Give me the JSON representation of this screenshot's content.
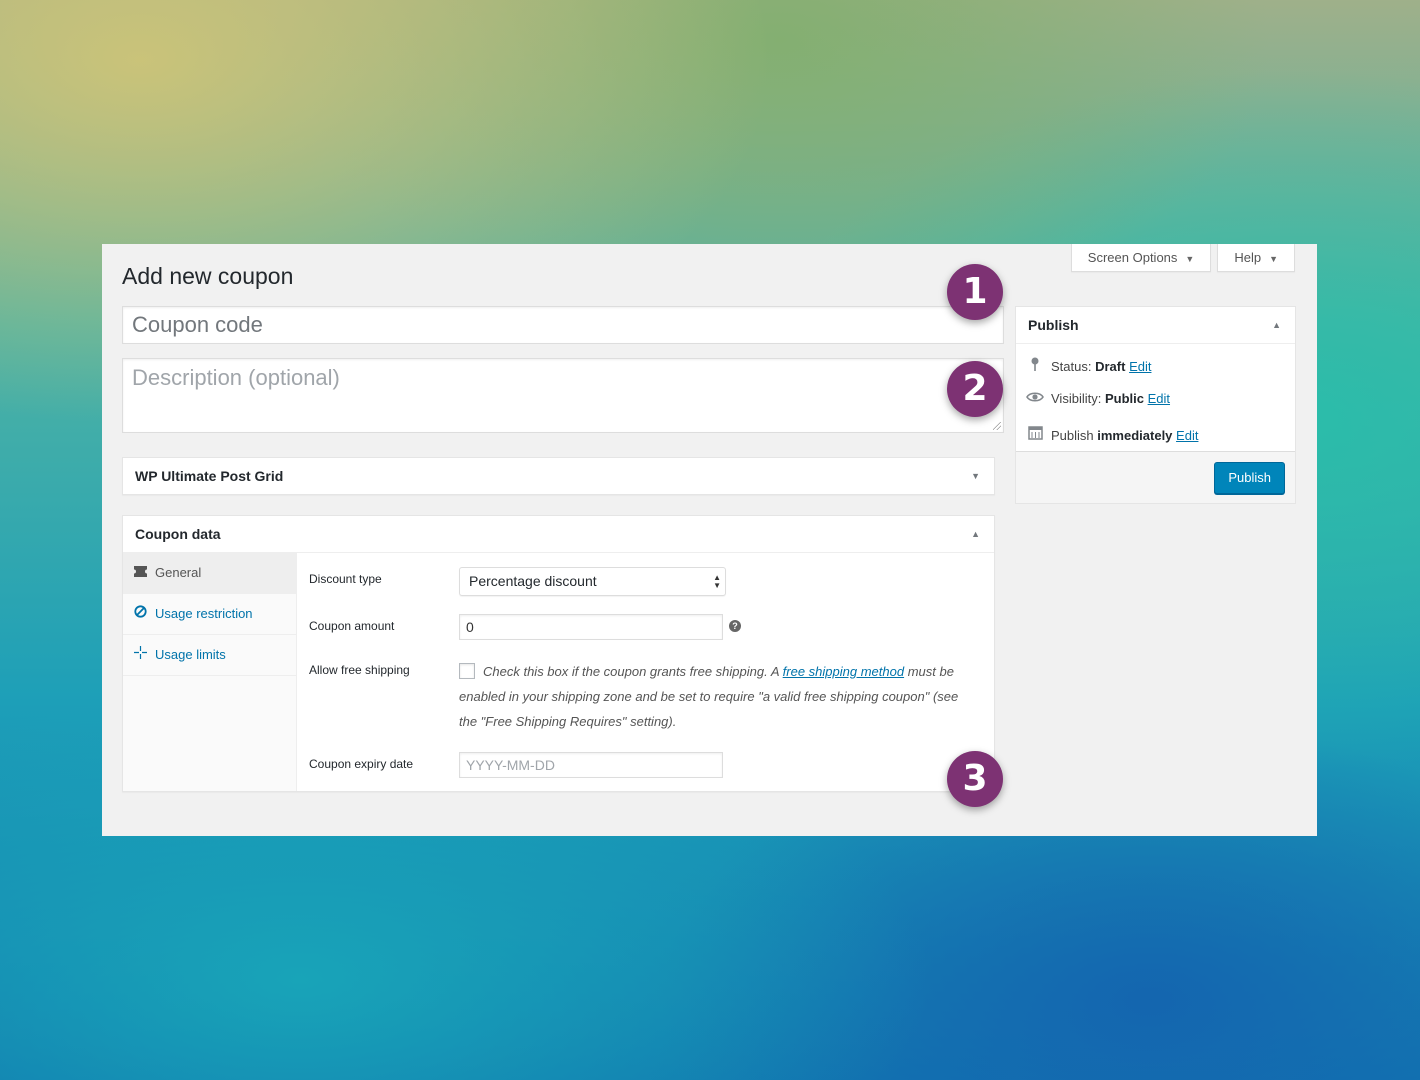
{
  "top_tabs": {
    "screen_options": "Screen Options",
    "help": "Help"
  },
  "page_title": "Add new coupon",
  "coupon_code": {
    "placeholder": "Coupon code"
  },
  "description": {
    "placeholder": "Description (optional)"
  },
  "metaboxes": {
    "ultimate_post_grid": {
      "title": "WP Ultimate Post Grid"
    },
    "coupon_data": {
      "title": "Coupon data"
    }
  },
  "coupon_tabs": [
    {
      "label": "General",
      "icon": "ticket-icon"
    },
    {
      "label": "Usage restriction",
      "icon": "block-icon"
    },
    {
      "label": "Usage limits",
      "icon": "crosshair-icon"
    }
  ],
  "general": {
    "discount_type": {
      "label": "Discount type",
      "value": "Percentage discount"
    },
    "coupon_amount": {
      "label": "Coupon amount",
      "value": "0"
    },
    "free_shipping": {
      "label": "Allow free shipping",
      "desc_before": "Check this box if the coupon grants free shipping. A ",
      "link_text": "free shipping method",
      "desc_after": " must be enabled in your shipping zone and be set to require \"a valid free shipping coupon\" (see the \"Free Shipping Requires\" setting)."
    },
    "expiry": {
      "label": "Coupon expiry date",
      "placeholder": "YYYY-MM-DD"
    }
  },
  "publish": {
    "title": "Publish",
    "status_label": "Status:",
    "status_value": "Draft",
    "visibility_label": "Visibility:",
    "visibility_value": "Public",
    "schedule_label": "Publish",
    "schedule_value": "immediately",
    "edit": "Edit",
    "button": "Publish"
  },
  "badges": [
    "1",
    "2",
    "3"
  ],
  "colors": {
    "accent": "#0085ba",
    "badge": "#7d3273",
    "link": "#0073aa"
  }
}
